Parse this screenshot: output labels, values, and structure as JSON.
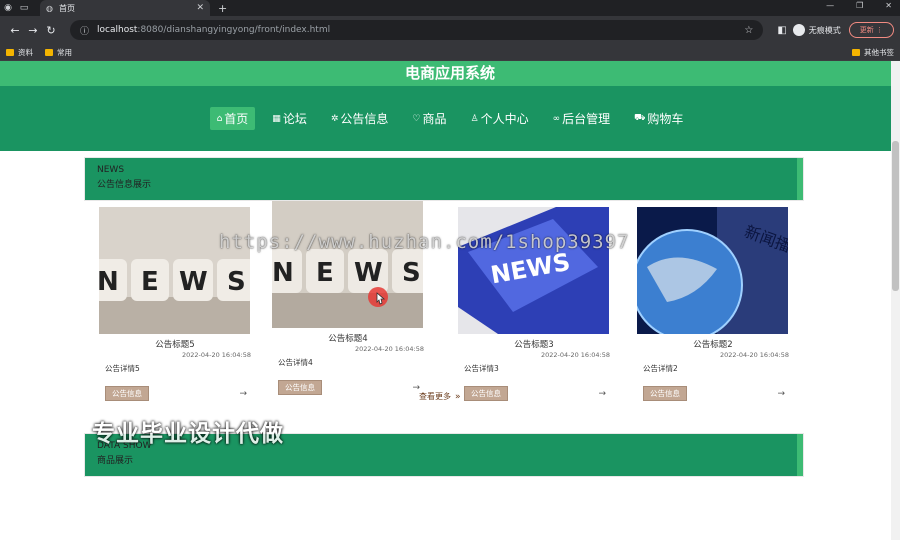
{
  "browser": {
    "tab_title": "首页",
    "url_host": "localhost",
    "url_path": ":8080/dianshangyingyong/front/index.html",
    "profile_label": "无痕模式",
    "update_label": "更新",
    "bookmarks": [
      "资料",
      "常用"
    ],
    "other_bookmarks": "其他书签"
  },
  "site": {
    "title": "电商应用系统",
    "nav": [
      {
        "label": "首页",
        "icon": "home-icon",
        "glyph": "⌂"
      },
      {
        "label": "论坛",
        "icon": "forum-icon",
        "glyph": "▦"
      },
      {
        "label": "公告信息",
        "icon": "notice-icon",
        "glyph": "✲"
      },
      {
        "label": "商品",
        "icon": "product-icon",
        "glyph": "♡"
      },
      {
        "label": "个人中心",
        "icon": "user-icon",
        "glyph": "♙"
      },
      {
        "label": "后台管理",
        "icon": "link-icon",
        "glyph": "∞"
      },
      {
        "label": "购物车",
        "icon": "cart-icon",
        "glyph": "⛟"
      }
    ]
  },
  "news_section": {
    "en": "NEWS",
    "cn": "公告信息展示",
    "cards": [
      {
        "title": "公告标题5",
        "date": "2022-04-20 16:04:58",
        "detail": "公告详情5",
        "tag": "公告信息",
        "image": "news-dice"
      },
      {
        "title": "公告标题4",
        "date": "2022-04-20 16:04:58",
        "detail": "公告详情4",
        "tag": "公告信息",
        "image": "news-dice"
      },
      {
        "title": "公告标题3",
        "date": "2022-04-20 16:04:58",
        "detail": "公告详情3",
        "tag": "公告信息",
        "image": "news-key"
      },
      {
        "title": "公告标题2",
        "date": "2022-04-20 16:04:58",
        "detail": "公告详情2",
        "tag": "公告信息",
        "image": "news-globe"
      }
    ],
    "more": "查看更多"
  },
  "data_section": {
    "en": "DATA SHOW",
    "cn": "商品展示"
  },
  "watermarks": {
    "url": "https://www.huzhan.com/1shop39397",
    "cn": "专业毕业设计代做"
  },
  "globe_caption": "新闻播报",
  "colors": {
    "brand_green": "#1a9461",
    "light_green": "#3dbb74",
    "tag_tan": "#c2a793"
  }
}
